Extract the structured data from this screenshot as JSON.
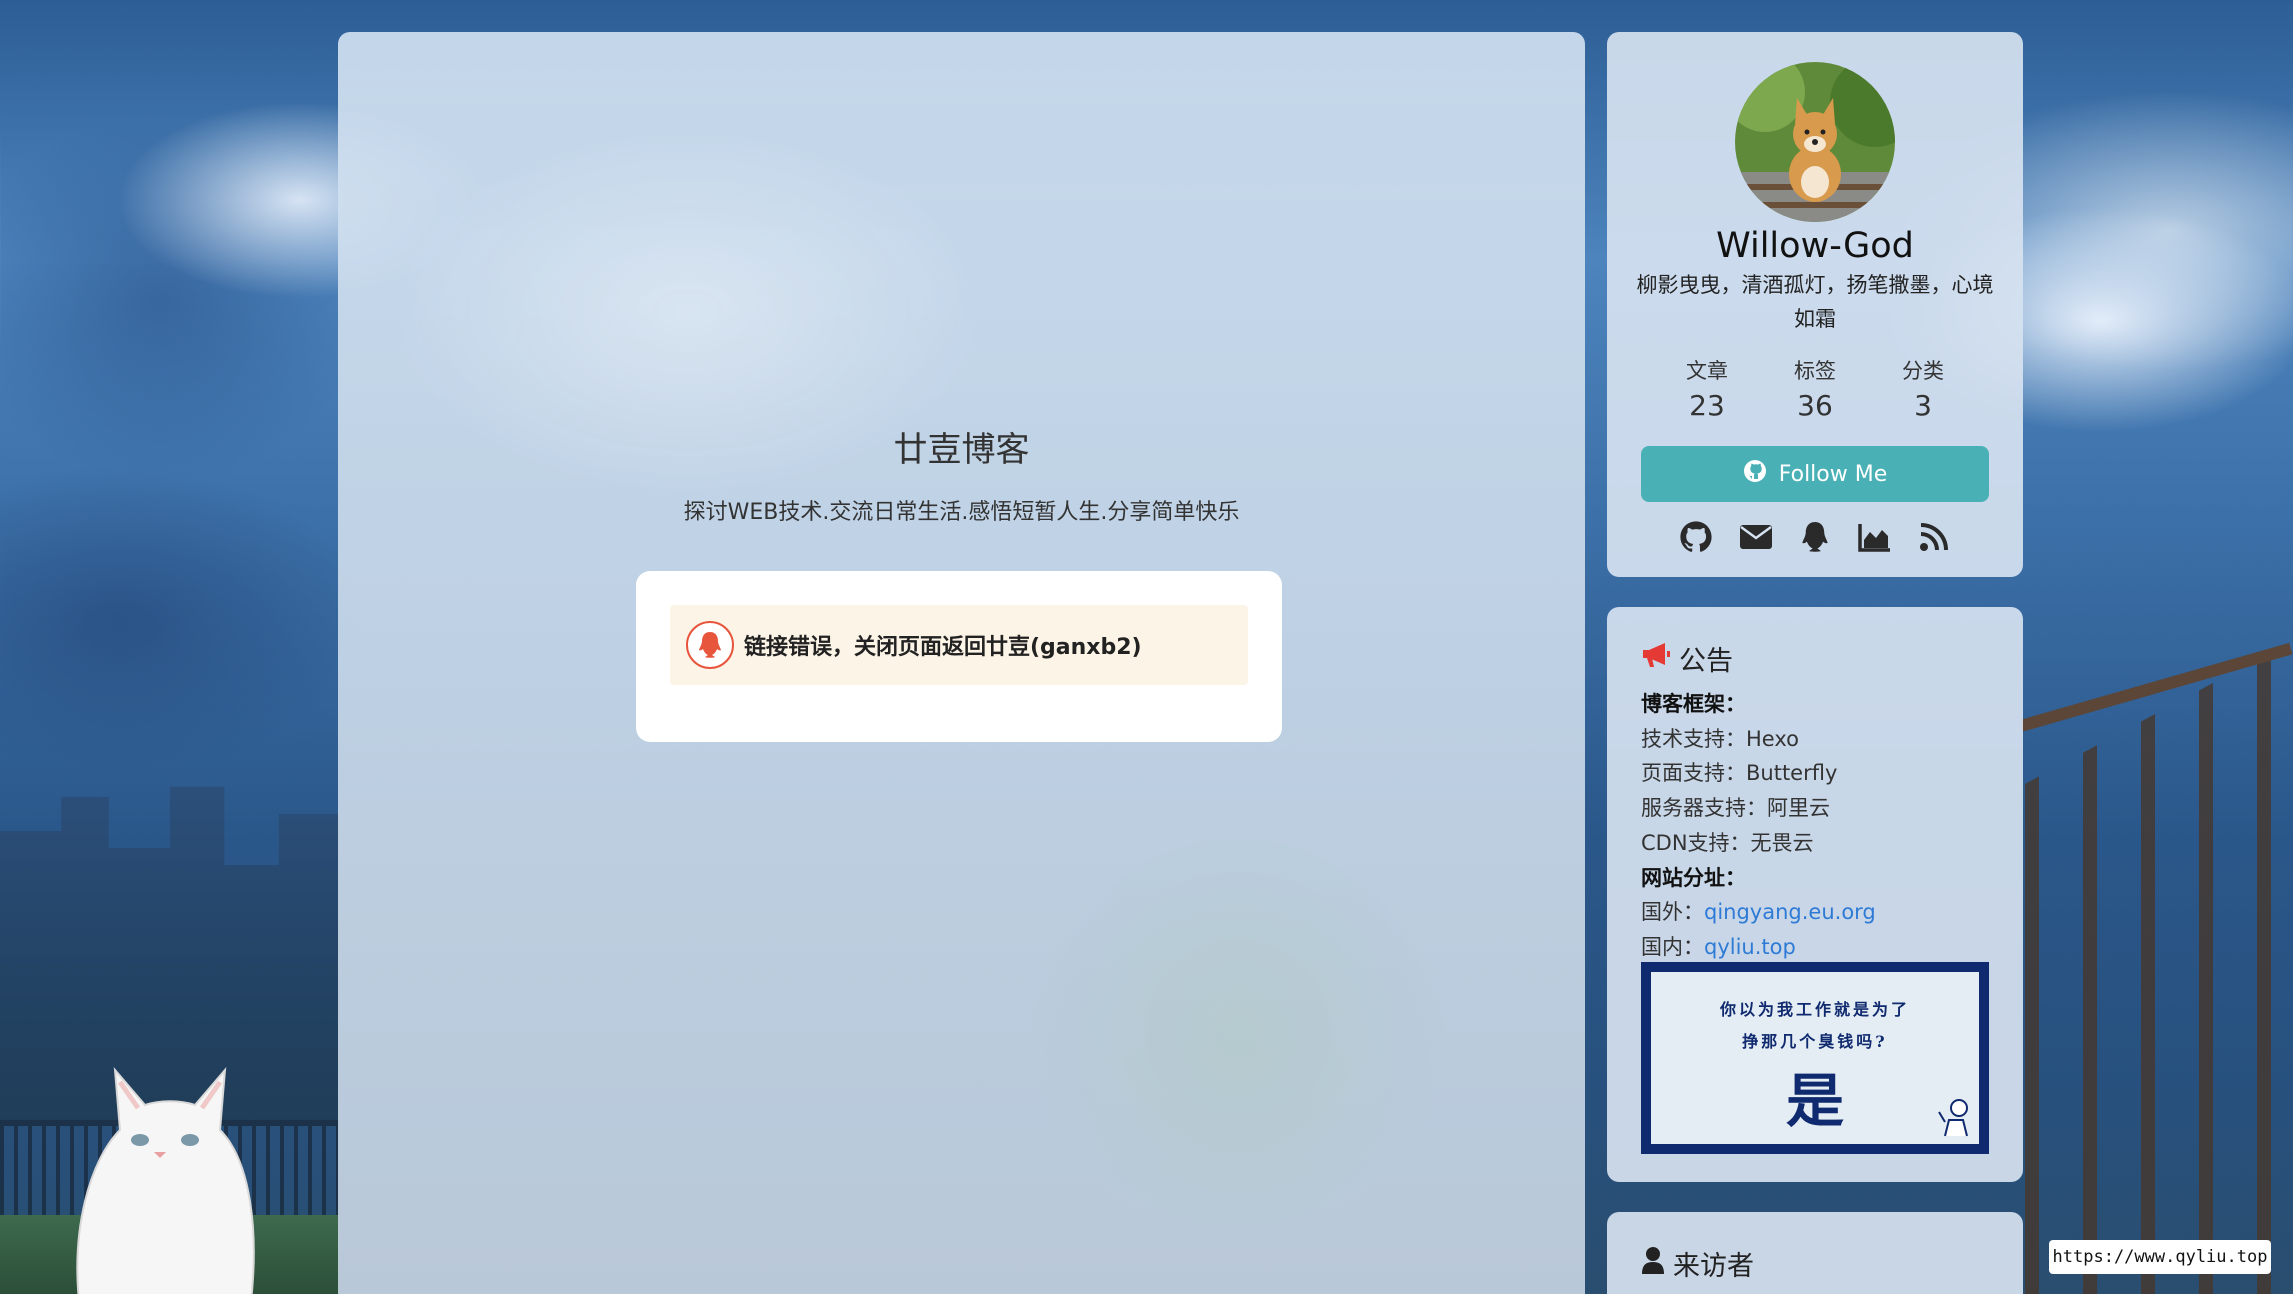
{
  "main": {
    "site_title": "廿壴博客",
    "site_subtitle": "探讨WEB技术.交流日常生活.感悟短暂人生.分享简单快乐",
    "error_message": "链接错误，关闭页面返回廿壴(ganxb2)"
  },
  "profile": {
    "name": "Willow-God",
    "description": "柳影曳曳，清酒孤灯，扬笔撒墨，心境如霜",
    "stats": [
      {
        "label": "文章",
        "value": "23"
      },
      {
        "label": "标签",
        "value": "36"
      },
      {
        "label": "分类",
        "value": "3"
      }
    ],
    "follow_label": "Follow Me",
    "social_icons": [
      "github-icon",
      "email-icon",
      "qq-icon",
      "stats-icon",
      "rss-icon"
    ]
  },
  "announcement": {
    "title": "公告",
    "lines": [
      {
        "type": "heading",
        "text": "博客框架："
      },
      {
        "label": "技术支持：",
        "value": "Hexo"
      },
      {
        "label": "页面支持：",
        "value": "Butterfly"
      },
      {
        "label": "服务器支持：",
        "value": "阿里云"
      },
      {
        "label": "CDN支持：",
        "value": "无畏云"
      },
      {
        "type": "heading",
        "text": "网站分址："
      },
      {
        "label": "国外：",
        "link": "qingyang.eu.org"
      },
      {
        "label": "国内：",
        "link": "qyliu.top"
      }
    ],
    "poster": {
      "line1": "你以为我工作就是为了",
      "line2": "挣那几个臭钱吗?",
      "big": "是"
    }
  },
  "visitor": {
    "title": "来访者"
  },
  "url_tag": "https://www.qyliu.top",
  "colors": {
    "accent": "#49b1b5",
    "link": "#2e7bd6",
    "alert_bg": "#fcf4e6",
    "alert_icon": "#e8553d",
    "megaphone": "#e53935"
  }
}
